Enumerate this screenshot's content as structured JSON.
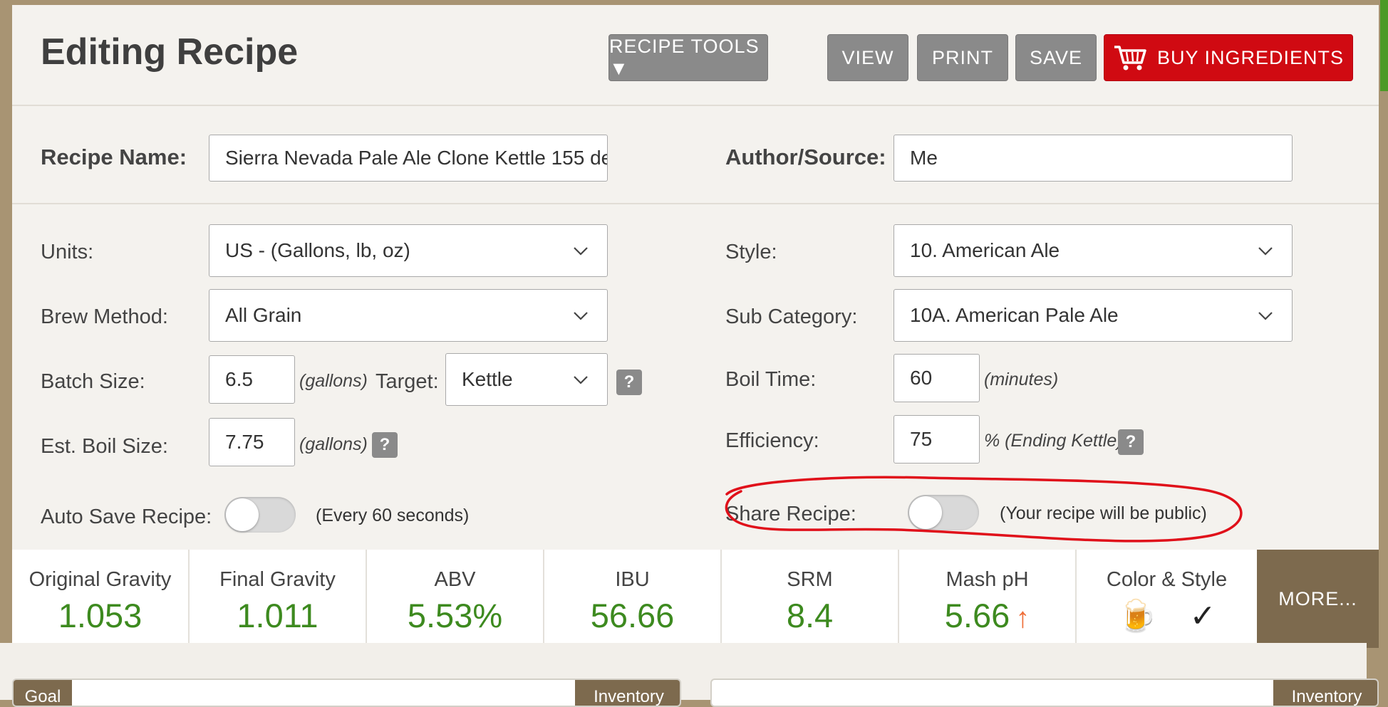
{
  "header": {
    "title": "Editing Recipe",
    "buttons": {
      "recipe_tools": "RECIPE TOOLS ▼",
      "view": "VIEW",
      "print": "PRINT",
      "save": "SAVE",
      "buy": "BUY INGREDIENTS"
    }
  },
  "recipe": {
    "name_label": "Recipe Name:",
    "name_value": "Sierra Nevada Pale Ale Clone Kettle 155 de",
    "author_label": "Author/Source:",
    "author_value": "Me"
  },
  "settings": {
    "units_label": "Units:",
    "units_value": "US - (Gallons, lb, oz)",
    "brew_method_label": "Brew Method:",
    "brew_method_value": "All Grain",
    "batch_size_label": "Batch Size:",
    "batch_size_value": "6.5",
    "batch_unit": "(gallons)",
    "target_label": "Target:",
    "target_value": "Kettle",
    "boil_size_label": "Est. Boil Size:",
    "boil_size_value": "7.75",
    "boil_size_unit": "(gallons)",
    "auto_save_label": "Auto Save Recipe:",
    "auto_save_note": "(Every 60 seconds)",
    "style_label": "Style:",
    "style_value": "10. American Ale",
    "sub_category_label": "Sub Category:",
    "sub_category_value": "10A. American Pale Ale",
    "boil_time_label": "Boil Time:",
    "boil_time_value": "60",
    "boil_time_unit": "(minutes)",
    "efficiency_label": "Efficiency:",
    "efficiency_value": "75",
    "efficiency_unit": "% (Ending Kettle)",
    "share_label": "Share Recipe:",
    "share_note": "(Your recipe will be public)",
    "help_glyph": "?"
  },
  "stats": {
    "og_label": "Original Gravity",
    "og_value": "1.053",
    "fg_label": "Final Gravity",
    "fg_value": "1.011",
    "abv_label": "ABV",
    "abv_value": "5.53%",
    "ibu_label": "IBU",
    "ibu_value": "56.66",
    "srm_label": "SRM",
    "srm_value": "8.4",
    "ph_label": "Mash pH",
    "ph_value": "5.66",
    "ph_arrow": "↑",
    "color_label": "Color & Style",
    "color_emoji": "🍺",
    "color_check": "✓",
    "more": "MORE..."
  },
  "bottom": {
    "goal_tab": "Goal",
    "inventory_tab_left": "Inventory",
    "inventory_tab_right": "Inventory"
  },
  "colors": {
    "accent_green": "#3d8a1f",
    "buy_red": "#d00a12",
    "button_gray": "#8a8a8a",
    "brown": "#7d6a4e",
    "annotation_red": "#e0101a"
  }
}
